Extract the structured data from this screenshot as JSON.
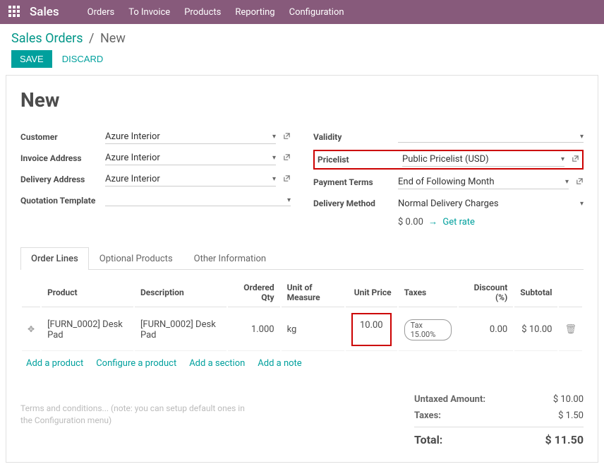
{
  "app": {
    "name": "Sales"
  },
  "menu": [
    "Orders",
    "To Invoice",
    "Products",
    "Reporting",
    "Configuration"
  ],
  "breadcrumb": {
    "main": "Sales Orders",
    "current": "New"
  },
  "buttons": {
    "save": "SAVE",
    "discard": "DISCARD"
  },
  "title": "New",
  "left_fields": {
    "customer": {
      "label": "Customer",
      "value": "Azure Interior"
    },
    "invoice": {
      "label": "Invoice Address",
      "value": "Azure Interior"
    },
    "delivery": {
      "label": "Delivery Address",
      "value": "Azure Interior"
    },
    "template": {
      "label": "Quotation Template",
      "value": ""
    }
  },
  "right_fields": {
    "validity": {
      "label": "Validity",
      "value": ""
    },
    "pricelist": {
      "label": "Pricelist",
      "value": "Public Pricelist (USD)"
    },
    "payment": {
      "label": "Payment Terms",
      "value": "End of Following Month"
    },
    "delivery_method": {
      "label": "Delivery Method",
      "value": "Normal Delivery Charges"
    },
    "rate": {
      "amount": "$ 0.00",
      "link": "Get rate"
    }
  },
  "tabs": [
    "Order Lines",
    "Optional Products",
    "Other Information"
  ],
  "table": {
    "headers": {
      "product": "Product",
      "description": "Description",
      "qty": "Ordered Qty",
      "uom": "Unit of Measure",
      "unit_price": "Unit Price",
      "taxes": "Taxes",
      "discount": "Discount (%)",
      "subtotal": "Subtotal"
    },
    "row": {
      "product": "[FURN_0002] Desk Pad",
      "description": "[FURN_0002] Desk Pad",
      "qty": "1.000",
      "uom": "kg",
      "unit_price": "10.00",
      "tax": "Tax 15.00%",
      "discount": "0.00",
      "subtotal": "$ 10.00"
    },
    "links": {
      "add_product": "Add a product",
      "configure": "Configure a product",
      "add_section": "Add a section",
      "add_note": "Add a note"
    }
  },
  "terms": "Terms and conditions... (note: you can setup default ones in the Configuration menu)",
  "totals": {
    "untaxed": {
      "label": "Untaxed Amount:",
      "value": "$ 10.00"
    },
    "taxes": {
      "label": "Taxes:",
      "value": "$ 1.50"
    },
    "total": {
      "label": "Total:",
      "value": "$ 11.50"
    }
  }
}
